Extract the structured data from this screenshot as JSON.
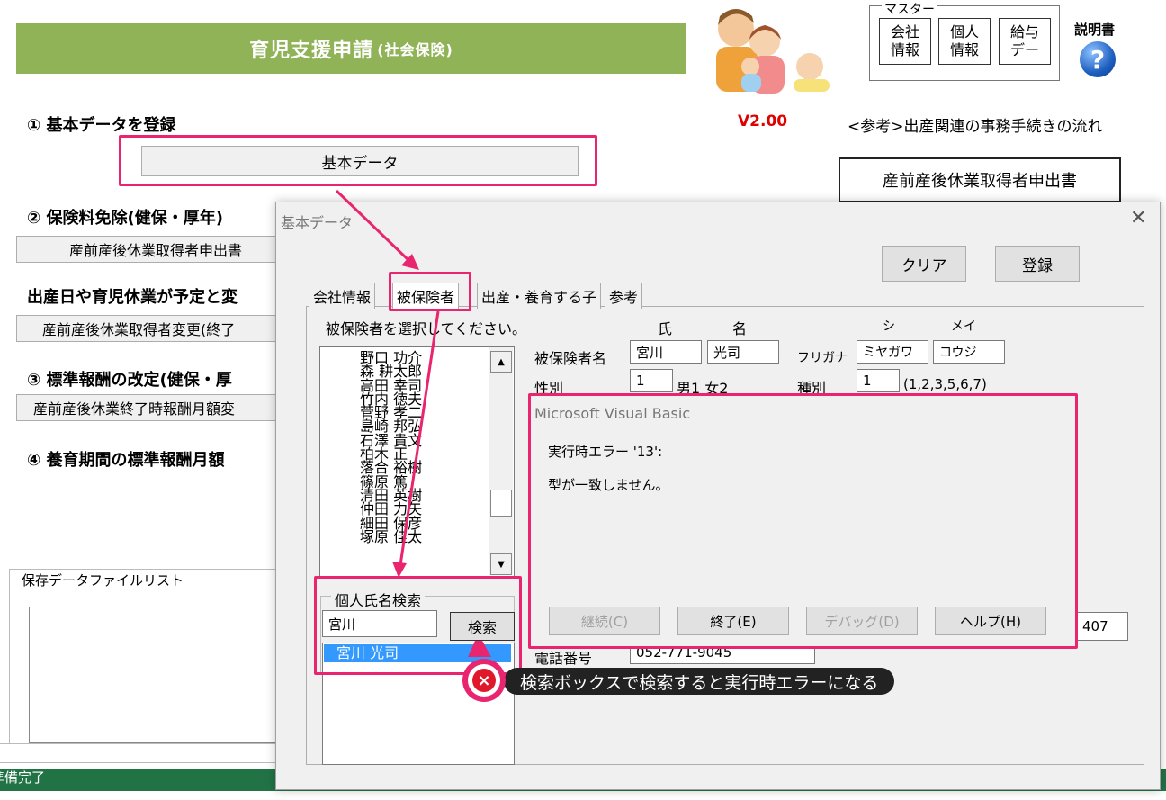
{
  "sheet": {
    "title": "育児支援申請",
    "title_sub": "(社会保険)",
    "master_label": "マスター",
    "master_buttons": [
      "会社\n情報",
      "個人\n情報",
      "給与\nデー"
    ],
    "help_label": "説明書",
    "help_icon": "?",
    "version": "V2.00",
    "reference_text": "<参考>出産関連の事務手続きの流れ",
    "right_button": "産前産後休業取得者申出書",
    "section1": "① 基本データを登録",
    "basic_data_button": "基本データ",
    "section2": "② 保険料免除(健保・厚年)",
    "row_btn2": "産前産後休業取得者申出書",
    "section_birth": "出産日や育児休業が予定と変",
    "row_btn_birth": "産前産後休業取得者変更(終了",
    "section3": "③ 標準報酬の改定(健保・厚",
    "row_btn3": "産前産後休業終了時報酬月額変",
    "section4": "④ 養育期間の標準報酬月額",
    "save_list_label": "保存データファイルリスト",
    "status": "準備完了"
  },
  "dialog": {
    "title": "基本データ",
    "close": "✕",
    "clear_button": "クリア",
    "register_button": "登録",
    "tabs": [
      "会社情報",
      "被保険者",
      "出産・養育する子",
      "参考"
    ],
    "instruction": "被保険者を選択してください。",
    "col_sei": "氏",
    "col_mei": "名",
    "col_shi": "シ",
    "col_mei_kana": "メイ",
    "insured_name_label": "被保険者名",
    "last_name": "宮川",
    "first_name": "光司",
    "furigana_label": "フリガナ",
    "last_kana": "ミヤガワ",
    "first_kana": "コウジ",
    "gender_label": "性別",
    "gender_value": "1",
    "gender_hint": "男1 女2",
    "type_label": "種別",
    "type_value": "1",
    "type_hint": "(1,2,3,5,6,7)",
    "list_items": [
      "野口 功介",
      "森 耕太郎",
      "高田 幸司",
      "竹内 徳夫",
      "菅野 孝二",
      "島崎 邦弘",
      "石澤 貴文",
      "柏木 正",
      "落合 裕樹",
      "篠原 篤",
      "清田 英樹",
      "仲田 力矢",
      "細田 保彦",
      "塚原 佳太"
    ],
    "search_group_label": "個人氏名検索",
    "search_value": "宮川",
    "search_button": "検索",
    "search_result": "宮川 光司",
    "phone_label": "電話番号",
    "phone_value": "052-771-9045",
    "partial_field": "407"
  },
  "msgbox": {
    "title": "Microsoft Visual Basic",
    "line1": "実行時エラー '13':",
    "line2": "型が一致しません。",
    "buttons": [
      "継続(C)",
      "終了(E)",
      "デバッグ(D)",
      "ヘルプ(H)"
    ]
  },
  "callout": {
    "text": "検索ボックスで検索すると実行時エラーになる",
    "icon": "×"
  },
  "colors": {
    "banner": "#8fb356",
    "highlight": "#e8256e",
    "version": "#e00000",
    "status_bar": "#217346",
    "selection": "#3399ff"
  }
}
